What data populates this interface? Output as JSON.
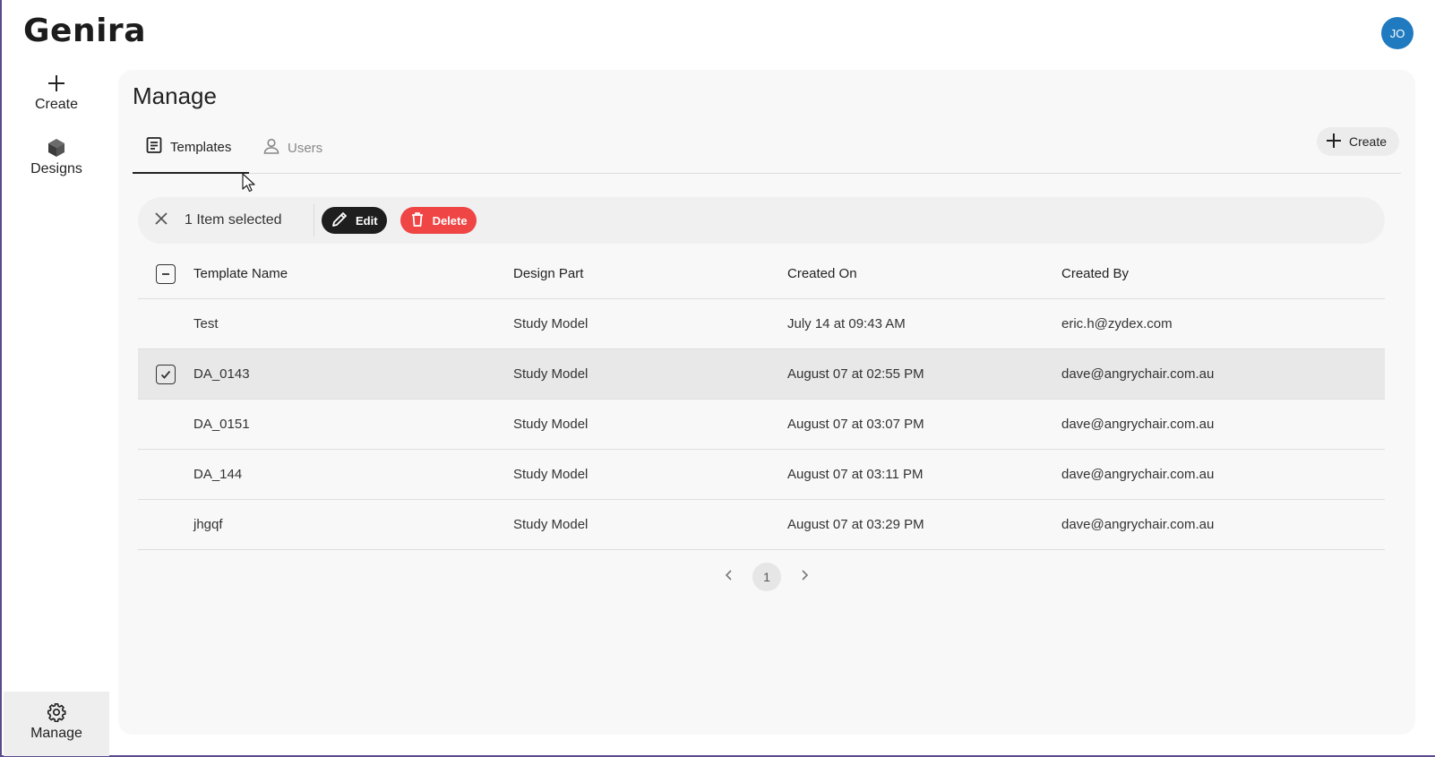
{
  "app": {
    "logo": "Genira",
    "avatar_initials": "JO",
    "accent_color": "#1f7ac0"
  },
  "sidebar": {
    "items": [
      {
        "label": "Create",
        "icon": "plus-icon"
      },
      {
        "label": "Designs",
        "icon": "cube-icon"
      },
      {
        "label": "Manage",
        "icon": "gear-icon",
        "active": true
      }
    ]
  },
  "main": {
    "title": "Manage",
    "tabs": [
      {
        "label": "Templates",
        "icon": "document-list-icon",
        "active": true
      },
      {
        "label": "Users",
        "icon": "user-icon",
        "active": false
      }
    ],
    "create_label": "Create"
  },
  "selection": {
    "text": "1 Item selected",
    "edit_label": "Edit",
    "delete_label": "Delete",
    "delete_color": "#f04545"
  },
  "table": {
    "columns": [
      "Template Name",
      "Design Part",
      "Created On",
      "Created By"
    ],
    "rows": [
      {
        "name": "Test",
        "part": "Study Model",
        "created_on": "July 14 at 09:43 AM",
        "created_by": "eric.h@zydex.com",
        "selected": false
      },
      {
        "name": "DA_0143",
        "part": "Study Model",
        "created_on": "August 07 at 02:55 PM",
        "created_by": "dave@angrychair.com.au",
        "selected": true
      },
      {
        "name": "DA_0151",
        "part": "Study Model",
        "created_on": "August 07 at 03:07 PM",
        "created_by": "dave@angrychair.com.au",
        "selected": false
      },
      {
        "name": "DA_144",
        "part": "Study Model",
        "created_on": "August 07 at 03:11 PM",
        "created_by": "dave@angrychair.com.au",
        "selected": false
      },
      {
        "name": "jhgqf",
        "part": "Study Model",
        "created_on": "August 07 at 03:29 PM",
        "created_by": "dave@angrychair.com.au",
        "selected": false
      }
    ]
  },
  "pagination": {
    "current_page": "1"
  }
}
